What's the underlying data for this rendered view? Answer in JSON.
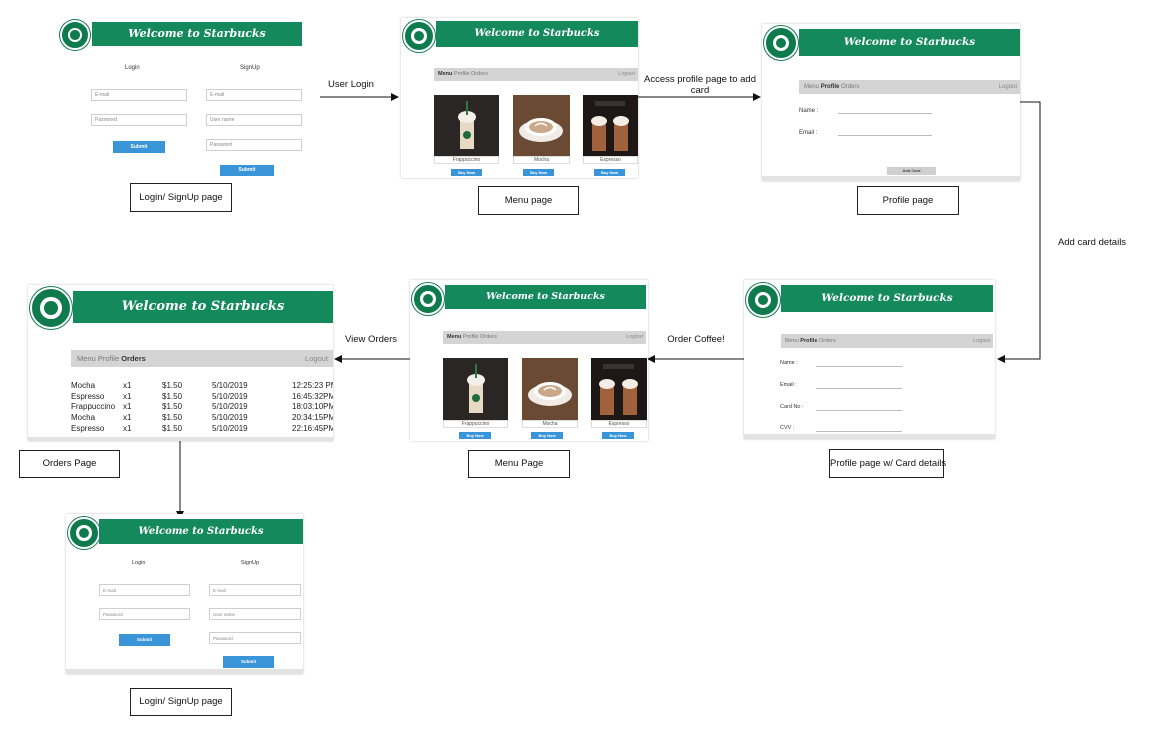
{
  "brand": {
    "banner_text": "Welcome to Starbucks",
    "logo_text": "STARBUCKS COFFEE",
    "green": "#148a5c",
    "button_blue": "#3a95d8"
  },
  "login_page": {
    "login_heading": "Login",
    "signup_heading": "SignUp",
    "email_placeholder": "E-mail",
    "password_placeholder": "Password",
    "username_placeholder": "User name",
    "submit_label": "Submit"
  },
  "nav": {
    "menu": "Menu",
    "profile": "Profile",
    "orders": "Orders",
    "logout": "Logout"
  },
  "menu_items": [
    {
      "name": "Frappuccino",
      "photo": "frappuccino-cup-image"
    },
    {
      "name": "Mocha",
      "photo": "mocha-cup-image"
    },
    {
      "name": "Espresso",
      "photo": "espresso-drinks-image"
    }
  ],
  "buy_label": "Buy Now",
  "profile_page": {
    "name_label": "Name :",
    "email_label": "Email :",
    "add_card_label": "Add Card"
  },
  "profile_card_page": {
    "name_label": "Name :",
    "email_label": "Email :",
    "card_label": "Card No :",
    "cvv_label": "CVV :"
  },
  "orders": [
    {
      "item": "Mocha",
      "qty": "x1",
      "price": "$1.50",
      "date": "5/10/2019",
      "time": "12:25:23 PM"
    },
    {
      "item": "Espresso",
      "qty": "x1",
      "price": "$1.50",
      "date": "5/10/2019",
      "time": "16:45:32PM"
    },
    {
      "item": "Frappuccino",
      "qty": "x1",
      "price": "$1.50",
      "date": "5/10/2019",
      "time": "18:03:10PM"
    },
    {
      "item": "Mocha",
      "qty": "x1",
      "price": "$1.50",
      "date": "5/10/2019",
      "time": "20:34:15PM"
    },
    {
      "item": "Espresso",
      "qty": "x1",
      "price": "$1.50",
      "date": "5/10/2019",
      "time": "22:16:45PM"
    }
  ],
  "captions": {
    "login1": "Login/ SignUp page",
    "menu1": "Menu page",
    "profile1": "Profile page",
    "profile2": "Profile page w/ Card details",
    "menu2": "Menu Page",
    "orders": "Orders Page",
    "login2": "Login/ SignUp page"
  },
  "edges": {
    "user_login": "User Login",
    "access_profile": "Access profile page to add card",
    "add_card_details": "Add card details",
    "order_coffee": "Order Coffee!",
    "view_orders": "View Orders"
  }
}
